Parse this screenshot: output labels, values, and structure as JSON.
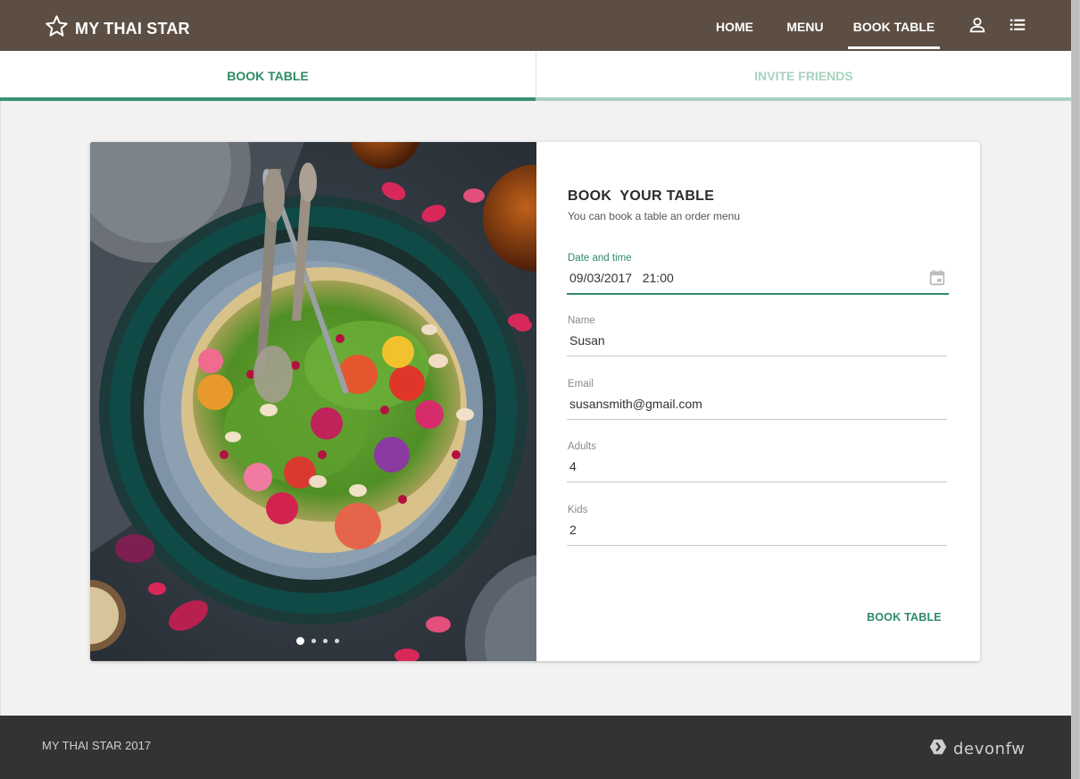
{
  "app": {
    "brand_name": "MY THAI STAR",
    "brand_icon": "star-outline-icon",
    "toolbar_color": "#5d4e43"
  },
  "nav": {
    "items": [
      {
        "label": "HOME"
      },
      {
        "label": "MENU"
      },
      {
        "label": "BOOK TABLE",
        "active": true
      }
    ],
    "icons": [
      "user-icon",
      "list-icon"
    ]
  },
  "tabs": [
    {
      "label": "BOOK TABLE",
      "active": true
    },
    {
      "label": "INVITE FRIENDS",
      "active": false
    }
  ],
  "carousel": {
    "slide_count": 4,
    "active_index": 0,
    "image": "food-bowl-photo"
  },
  "form": {
    "title": "BOOK  YOUR TABLE",
    "subtitle": "You can book a table an order menu",
    "fields": {
      "date": {
        "label": "Date and time",
        "value": "09/03/2017   21:00",
        "icon": "calendar-icon"
      },
      "name": {
        "label": "Name",
        "value": "Susan"
      },
      "email": {
        "label": "Email",
        "value": "susansmith@gmail.com"
      },
      "adults": {
        "label": "Adults",
        "value": "4"
      },
      "kids": {
        "label": "Kids",
        "value": "2"
      }
    },
    "submit_label": "BOOK TABLE"
  },
  "footer": {
    "copyright": "MY THAI STAR 2017",
    "logo_text": "devonfw",
    "logo_icon": "devonfw-logo-icon"
  },
  "colors": {
    "accent": "#2e8b66",
    "accent_light": "#a7d2bf",
    "footer_bg": "#333333",
    "page_bg": "#f2f2f2"
  }
}
